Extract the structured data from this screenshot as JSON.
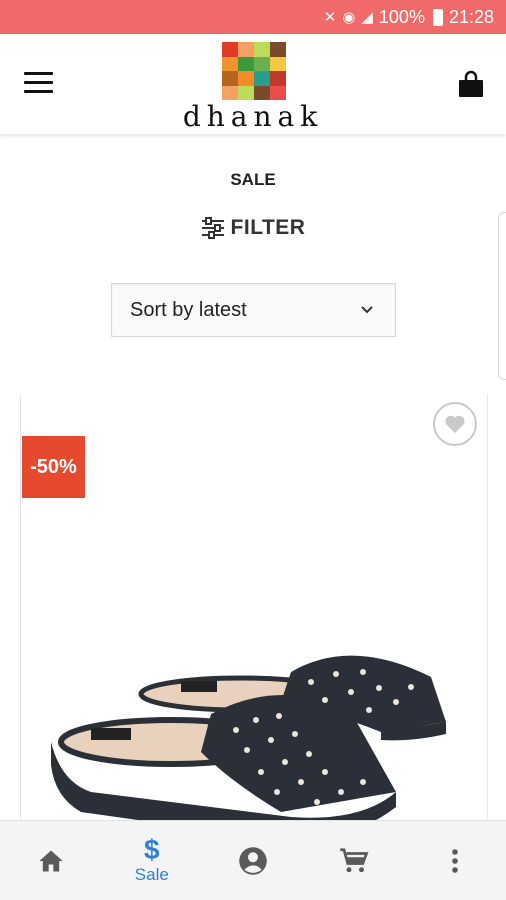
{
  "status_bar": {
    "battery": "100%",
    "time": "21:28",
    "icons": [
      "mute-icon",
      "wifi-icon",
      "signal-icon",
      "battery-icon"
    ]
  },
  "header": {
    "logo_text": "dhanak",
    "menu_icon": "hamburger-menu-icon",
    "cart_icon": "shopping-bag-icon"
  },
  "page": {
    "title": "SALE",
    "filter_label": "FILTER",
    "sort": {
      "selected": "Sort by latest"
    }
  },
  "product": {
    "discount_badge": "-50%",
    "wishlist_icon": "heart-icon"
  },
  "bottom_nav": {
    "items": [
      {
        "icon": "home-icon",
        "label": ""
      },
      {
        "icon": "dollar-icon",
        "label": "Sale",
        "active": true
      },
      {
        "icon": "account-icon",
        "label": ""
      },
      {
        "icon": "cart-icon",
        "label": ""
      },
      {
        "icon": "more-vertical-icon",
        "label": ""
      }
    ]
  },
  "colors": {
    "status_bar": "#f06a6a",
    "discount": "#e64a2e",
    "active_nav": "#2a83d8"
  }
}
